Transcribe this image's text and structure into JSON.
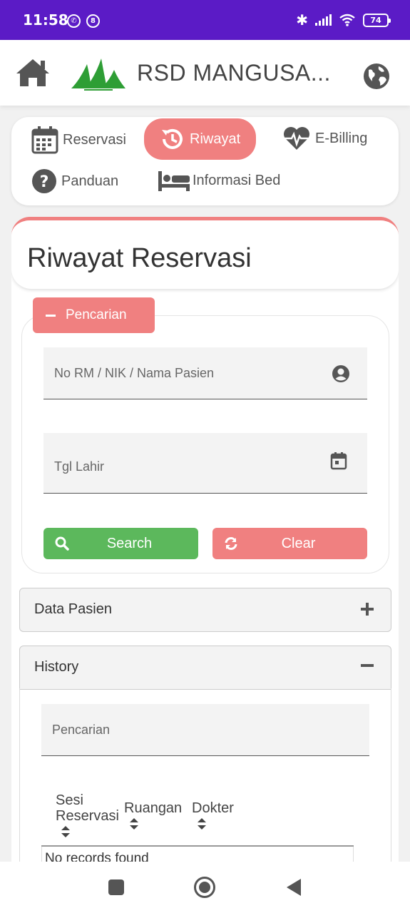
{
  "status_bar": {
    "time": "11:58",
    "battery": "74",
    "notif_badge": "8"
  },
  "header": {
    "title": "RSD MANGUSA..."
  },
  "nav": {
    "reservasi": "Reservasi",
    "riwayat": "Riwayat",
    "ebilling": "E-Billing",
    "panduan": "Panduan",
    "informasi_bed": "Informasi Bed"
  },
  "page": {
    "title": "Riwayat Reservasi"
  },
  "search": {
    "tab_label": "Pencarian",
    "name_placeholder": "No RM / NIK / Nama Pasien",
    "dob_placeholder": "Tgl Lahir",
    "search_label": "Search",
    "clear_label": "Clear"
  },
  "accordions": {
    "data_pasien": "Data Pasien",
    "history": "History"
  },
  "history": {
    "search_placeholder": "Pencarian",
    "columns": {
      "sesi_line1": "Sesi",
      "sesi_line2": "Reservasi",
      "ruangan": "Ruangan",
      "dokter": "Dokter"
    },
    "empty_message": "No records found"
  },
  "colors": {
    "accent": "#f08080",
    "success": "#5cb85c",
    "status_bar": "#5b1bc6",
    "logo_green": "#2e9e35"
  }
}
